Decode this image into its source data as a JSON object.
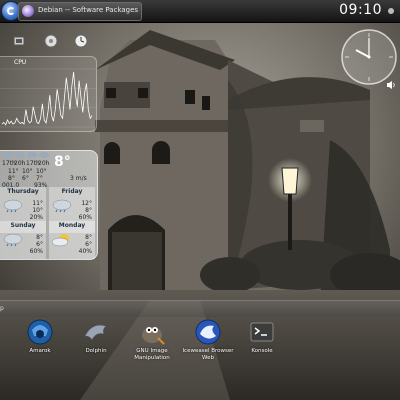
{
  "panel": {
    "task_title": "Debian -- Software Packages in S",
    "clock_time": "09:10"
  },
  "sysmon": {
    "cpu_label": "CPU",
    "cpu_history": [
      0.05,
      0.08,
      0.04,
      0.12,
      0.06,
      0.1,
      0.05,
      0.07,
      0.15,
      0.09,
      0.06,
      0.08,
      0.05,
      0.3,
      0.12,
      0.07,
      0.1,
      0.35,
      0.2,
      0.08,
      0.06,
      0.15,
      0.4,
      0.12,
      0.07,
      0.25,
      0.55,
      0.2,
      0.1,
      0.3,
      0.65,
      0.45,
      0.2,
      0.15,
      0.5,
      0.85,
      0.6,
      0.3,
      0.7,
      0.95,
      0.55,
      0.35,
      0.8,
      0.5,
      0.25,
      0.6,
      0.75,
      0.3,
      0.15,
      0.2
    ]
  },
  "weather": {
    "forecast_days": [
      "17th",
      "20h",
      "17th",
      "20h"
    ],
    "current_temp": "8°",
    "row_hi": [
      "11°",
      "10°",
      "10°"
    ],
    "row_lo": [
      "8°",
      "6°",
      "7°"
    ],
    "pressure": "001.0",
    "humidity": "93%",
    "wind": "3 m/s",
    "days": [
      {
        "name": "Thursday",
        "hi": "11°",
        "lo": "10°",
        "pct": "20%",
        "icon": "rain-cloud-icon"
      },
      {
        "name": "Friday",
        "hi": "12°",
        "lo": "8°",
        "pct": "60%",
        "icon": "rain-cloud-icon"
      },
      {
        "name": "Sunday",
        "hi": "8°",
        "lo": "6°",
        "pct": "60%",
        "icon": "rain-cloud-icon"
      },
      {
        "name": "Monday",
        "hi": "8°",
        "lo": "6°",
        "pct": "40%",
        "icon": "sun-cloud-icon"
      }
    ]
  },
  "launcher": {
    "bar_label": "p",
    "items": [
      {
        "label": "Amarok"
      },
      {
        "label": "Dolphin"
      },
      {
        "label": "GNU Image Manipulation"
      },
      {
        "label": "Iceweasel Browser Web"
      },
      {
        "label": "Konsole"
      }
    ]
  },
  "colors": {
    "panel": "#1e1e1e",
    "accent": "#3f76c9"
  }
}
